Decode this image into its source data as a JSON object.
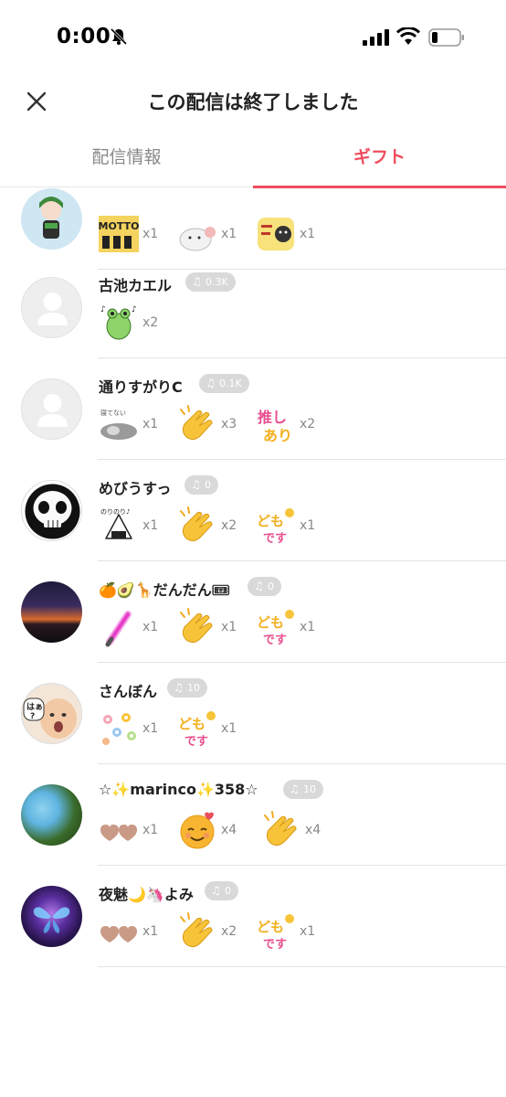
{
  "status": {
    "time": "0:00"
  },
  "header": {
    "title": "この配信は終了しました"
  },
  "tabs": [
    {
      "label": "配信情報",
      "active": false
    },
    {
      "label": "ギフト",
      "active": true
    }
  ],
  "colors": {
    "accent": "#ef4d5e",
    "badge": "#d9d9d9",
    "muted": "#888888"
  },
  "rows": [
    {
      "name": "",
      "badge": "",
      "gifts": [
        {
          "icon": "motto-sticker",
          "count": "x1"
        },
        {
          "icon": "cat-sticker",
          "count": "x1"
        },
        {
          "icon": "thanks-sticker",
          "count": "x1"
        }
      ]
    },
    {
      "name": "古池カエル",
      "badge": "0.3K",
      "gifts": [
        {
          "icon": "frog-sticker",
          "count": "x2"
        }
      ]
    },
    {
      "name": "通りすがりC",
      "badge": "0.1K",
      "gifts": [
        {
          "icon": "sleepy-cat-sticker",
          "count": "x1"
        },
        {
          "icon": "clap-emoji",
          "count": "x3"
        },
        {
          "icon": "oshi-ari-sticker",
          "count": "x2"
        }
      ]
    },
    {
      "name": "めびうすっ",
      "badge": "0",
      "gifts": [
        {
          "icon": "onigiri-sticker",
          "count": "x1"
        },
        {
          "icon": "clap-emoji",
          "count": "x2"
        },
        {
          "icon": "doumo-sticker",
          "count": "x1"
        }
      ]
    },
    {
      "name": "🍊🥑🦒だんだん🎟",
      "badge": "0",
      "gifts": [
        {
          "icon": "glowstick-sticker",
          "count": "x1"
        },
        {
          "icon": "clap-emoji",
          "count": "x1"
        },
        {
          "icon": "doumo-sticker",
          "count": "x1"
        }
      ]
    },
    {
      "name": "さんぼん",
      "badge": "10",
      "gifts": [
        {
          "icon": "flowers-sticker",
          "count": "x1"
        },
        {
          "icon": "doumo-sticker",
          "count": "x1"
        }
      ]
    },
    {
      "name": "☆✨marinco✨358☆",
      "badge": "10",
      "gifts": [
        {
          "icon": "hearts-sticker",
          "count": "x1"
        },
        {
          "icon": "smile-emoji",
          "count": "x4"
        },
        {
          "icon": "clap-emoji",
          "count": "x4"
        }
      ]
    },
    {
      "name": "夜魅🌙🦄よみ",
      "badge": "0",
      "gifts": [
        {
          "icon": "hearts-sticker",
          "count": "x1"
        },
        {
          "icon": "clap-emoji",
          "count": "x2"
        },
        {
          "icon": "doumo-sticker",
          "count": "x1"
        }
      ]
    }
  ]
}
